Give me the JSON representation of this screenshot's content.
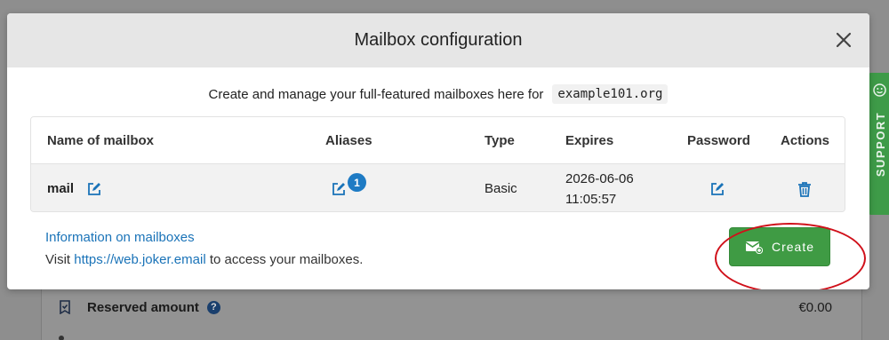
{
  "modal": {
    "title": "Mailbox configuration",
    "intro": "Create and manage your full-featured mailboxes here for",
    "domain": "example101.org"
  },
  "table": {
    "headers": [
      "Name of mailbox",
      "Aliases",
      "Type",
      "Expires",
      "Password",
      "Actions"
    ],
    "rows": [
      {
        "name": "mail",
        "alias_count": "1",
        "type": "Basic",
        "expires_date": "2026-06-06",
        "expires_time": "11:05:57"
      }
    ]
  },
  "footer": {
    "info_link": "Information on mailboxes",
    "visit_prefix": "Visit",
    "visit_url": "https://web.joker.email",
    "visit_suffix": "to access your mailboxes."
  },
  "create_button": {
    "label": "Create"
  },
  "support_tab": {
    "label": "SUPPORT"
  },
  "background": {
    "reserved_label": "Reserved amount",
    "reserved_value": "€0.00"
  },
  "colors": {
    "accent": "#1a73b8",
    "create_green": "#3f9b44",
    "highlight_red": "#d0101a",
    "support_green": "#3e9b48"
  }
}
